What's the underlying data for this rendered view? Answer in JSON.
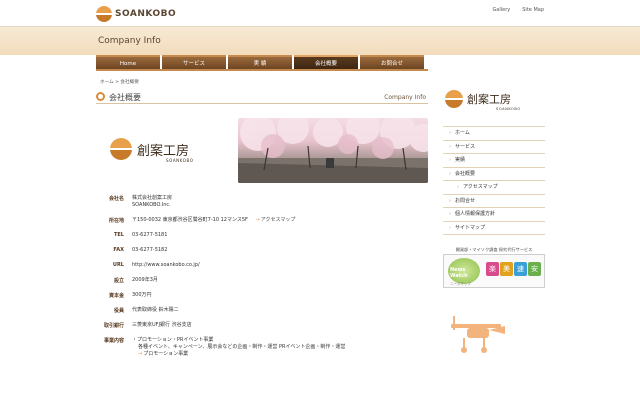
{
  "header": {
    "logo_text": "SOANKOBO",
    "links": [
      "Gallery",
      "Site Map"
    ]
  },
  "banner": {
    "title": "Company Info"
  },
  "nav": {
    "items": [
      {
        "label": "Home"
      },
      {
        "label": "サービス"
      },
      {
        "label": "実 績"
      },
      {
        "label": "会社概要"
      },
      {
        "label": "お問合せ"
      }
    ],
    "active_index": 3
  },
  "breadcrumb": "ホーム > 会社概要",
  "section": {
    "title": "会社概要",
    "en_title": "Company Info"
  },
  "main_logo": {
    "jp": "創案工房",
    "sub": "SOANKOBO"
  },
  "company": [
    {
      "label": "会社名",
      "lines": [
        "株式会社創案工房",
        "SOANKOBO.Inc."
      ]
    },
    {
      "label": "所在地",
      "lines": [
        "〒150-0032 東京都渋谷区鶯谷町7-10 12マンス5F"
      ],
      "link": "アクセスマップ"
    },
    {
      "label": "TEL",
      "lines": [
        "03-6277-5181"
      ]
    },
    {
      "label": "FAX",
      "lines": [
        "03-6277-5182"
      ]
    },
    {
      "label": "URL",
      "lines": [
        "http://www.soankobo.co.jp/"
      ]
    },
    {
      "label": "設立",
      "lines": [
        "2009年3月"
      ]
    },
    {
      "label": "資本金",
      "lines": [
        "300万円"
      ]
    },
    {
      "label": "役員",
      "lines": [
        "代表取締役 鈴木陽二"
      ]
    },
    {
      "label": "取引銀行",
      "lines": [
        "三菱東京UFJ銀行 渋谷支店"
      ]
    },
    {
      "label": "事業内容",
      "lines": [
        "・プロモーション・PRイベント事業",
        "各種イベント、キャンペーン、展示会などの企画・制作・運営 PRイベント企画・制作・運営"
      ],
      "link": "プロモーション事業"
    }
  ],
  "sidebar": {
    "logo_jp": "創案工房",
    "logo_sub": "SOANKOBO",
    "menu": [
      {
        "label": "ホーム",
        "child": false
      },
      {
        "label": "サービス",
        "child": false
      },
      {
        "label": "実績",
        "child": false
      },
      {
        "label": "会社概要",
        "child": false
      },
      {
        "label": "アクセスマップ",
        "child": true
      },
      {
        "label": "お問合せ",
        "child": false
      },
      {
        "label": "個人情報保護方針",
        "child": false
      },
      {
        "label": "サイトマップ",
        "child": false
      }
    ],
    "banner_title": "開発部・マイソク調査 探究代行サービス",
    "banner_news": "News Watch",
    "banner_keywords": [
      "楽",
      "美",
      "速",
      "安"
    ],
    "banner_keyword_colors": [
      "#d94a8c",
      "#e0a21e",
      "#3aa0d8",
      "#6ab04c"
    ],
    "banner_caption": "ニーズマップ"
  },
  "colors": {
    "accent": "#d98c3c",
    "nav": "#7a4e28",
    "brown_text": "#5a3a1e"
  }
}
